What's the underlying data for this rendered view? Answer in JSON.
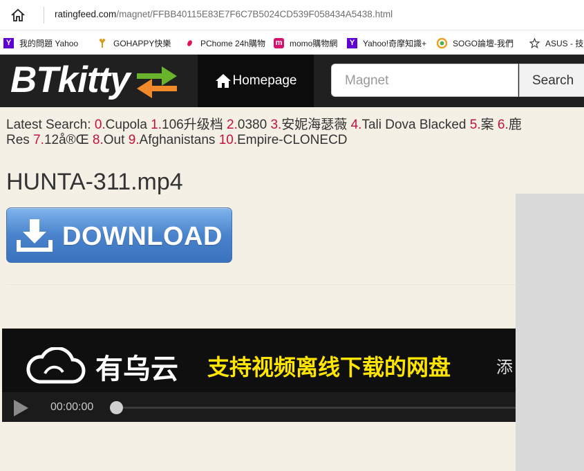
{
  "browser": {
    "url_domain": "ratingfeed.com",
    "url_path": "/magnet/FFBB40115E83E7F6C7B5024CD539F058434A5438.html",
    "bookmarks": [
      {
        "label": "我的問題 Yahoo",
        "icon": "yahoo-icon"
      },
      {
        "label": "GOHAPPY快樂",
        "icon": "gohappy-icon"
      },
      {
        "label": "PChome 24h購物",
        "icon": "pchome-icon"
      },
      {
        "label": "momo購物網",
        "icon": "momo-icon"
      },
      {
        "label": "Yahoo!奇摩知識+",
        "icon": "yahoo-icon"
      },
      {
        "label": "SOGO論壇-我們",
        "icon": "sogo-icon"
      },
      {
        "label": "ASUS - 技術",
        "icon": "star-icon"
      }
    ]
  },
  "header": {
    "logo": "BTkitty",
    "nav_home": "Homepage",
    "search_placeholder": "Magnet",
    "search_button": "Search"
  },
  "latest_search": {
    "label": "Latest Search:",
    "items": [
      {
        "num": "0.",
        "text": "Cupola"
      },
      {
        "num": "1.",
        "text": "106升级档"
      },
      {
        "num": "2.",
        "text": "0380"
      },
      {
        "num": "3.",
        "text": "安妮海瑟薇"
      },
      {
        "num": "4.",
        "text": "Tali Dova Blacked"
      },
      {
        "num": "5.",
        "text": "案"
      },
      {
        "num": "6.",
        "text": "鹿"
      },
      {
        "num": "",
        "text": "Res"
      },
      {
        "num": "7.",
        "text": "12å®Œ"
      },
      {
        "num": "8.",
        "text": "Out"
      },
      {
        "num": "9.",
        "text": "Afghanistans"
      },
      {
        "num": "10.",
        "text": "Empire-CLONECD"
      }
    ]
  },
  "main": {
    "title": "HUNTA-311.mp4",
    "download_label": "DOWNLOAD"
  },
  "video_ad": {
    "brand": "有乌云",
    "slogan": "支持视频离线下载的网盘",
    "extra": "添",
    "time": "00:00:00"
  },
  "colors": {
    "accent_number": "#c4113a",
    "header_bg": "#202020",
    "download_blue": "#4a83cc",
    "arrow_green": "#6ab42d",
    "arrow_orange": "#f0892a",
    "slogan_yellow": "#ffe500"
  }
}
